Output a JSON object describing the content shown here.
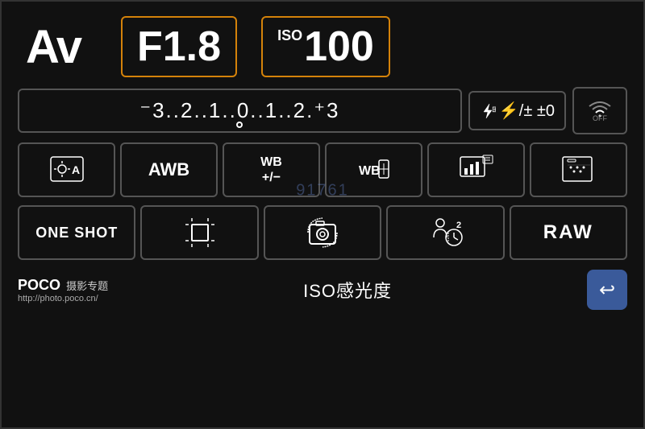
{
  "header": {
    "mode_label": "Av",
    "aperture_label": "F1.8",
    "iso_prefix": "ISO",
    "iso_value": "100"
  },
  "exposure": {
    "scale": "⁻3..2..1..0..1..2.⁺3",
    "flash_comp": "⚡±0",
    "wifi_status": "OFF"
  },
  "row2": {
    "cell1": "metering-auto",
    "cell2": "AWB",
    "cell3": "WB +/-",
    "cell4": "WB-shift",
    "cell5": "picture-style",
    "cell6": "af-point"
  },
  "row3": {
    "cell1": "ONE SHOT",
    "cell2": "af-area",
    "cell3": "drive",
    "cell4": "self-timer",
    "cell5": "RAW"
  },
  "footer": {
    "brand": "POCO",
    "brand_sub": "摄影专题",
    "website": "http://photo.poco.cn/",
    "iso_label": "ISO感光度",
    "back_icon": "↩"
  },
  "watermark": {
    "text": "91761"
  }
}
